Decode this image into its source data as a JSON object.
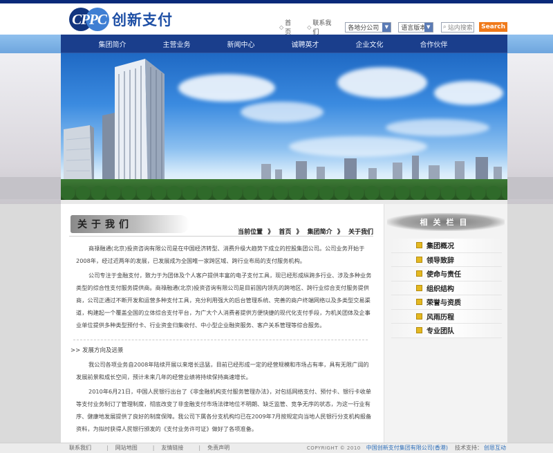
{
  "header": {
    "logo_mark": "CPPC",
    "logo_text": "创新支付",
    "links": [
      {
        "label": "首页"
      },
      {
        "label": "联系我们"
      }
    ],
    "region_select": "各地分公司",
    "language_select": "语言版本",
    "search_placeholder": "站内搜索",
    "search_button": "Search"
  },
  "nav": {
    "items": [
      "集团简介",
      "主营业务",
      "新闻中心",
      "诚聘英才",
      "企业文化",
      "合作伙伴"
    ]
  },
  "main": {
    "title": "关于我们",
    "breadcrumb": {
      "prefix": "当前位置",
      "sep": "》",
      "home": "首页",
      "section": "集团简介",
      "current": "关于我们"
    },
    "paragraphs": [
      "商祿融通(北京)投资咨询有限公司是在中国经济转型、消费升级大趋势下成立的控股集团公司。公司业务开始于2008年，经过近两年的发展，已发展成为全国唯一家跨区域、跨行业布局的支付服务机构。",
      "公司专注于金融支付，致力于为团体及个人客户提供丰富的电子支付工具，现已经形成纵跨多行业、涉及多种业务类型的综合性支付服务提供商。商祿融通(北京)投资咨询有限公司是目前国内领先的跨地区、跨行业综合支付服务提供商，公司正通过不断开发和运营多种支付工具，充分利用强大的后台管理系统、完善的商户终端网络以及多类型交易渠道，构建起一个覆盖全国的立体综合支付平台，为广大个人消费者提供方便快捷的现代化支付手段，为机关团体及企事业单位提供多种类型预付卡、行业资金归集收付、中小型企业融资服务、客户关系管理等综合服务。"
    ],
    "subhead": ">> 发展方向及远景",
    "paragraphs2": [
      "我公司各项业务自2008年陆续开展以来增长迅猛，目前已经形成一定的经营规模和市场占有率，具有无限广阔的发展前景和成长空间，预计未来几年的经营业绩将持续保持高速增长。",
      "2010年6月21日，中国人民银行出台了《非金融机构支付服务管理办法》，对包括网络支付、预付卡、银行卡收单等支付业务制订了管理制度，彻底改变了非金融支付市场法律地位不明朗、缺乏监管、竞争无序的状态，为这一行业有序、健康地发展提供了良好的制度保障。我公司下属各分支机构均已在2009年7月按规定向当地人民银行分支机构报备资料，为拟时获得人民银行颁发的《支付业务许可证》做好了各项准备。"
    ]
  },
  "sidebar": {
    "title": "相关栏目",
    "items": [
      "集团概况",
      "领导致辞",
      "使命与责任",
      "组织结构",
      "荣誉与资质",
      "风雨历程",
      "专业团队"
    ]
  },
  "footer": {
    "links": [
      "联系我们",
      "网站地图",
      "友情链接",
      "免责声明"
    ],
    "copyright": "COPYRIGHT © 2010",
    "company": "中国创新支付集团有限公司(香港)",
    "tech_label": "技术支持：",
    "tech_link": "创恩互动"
  },
  "colors": {
    "nav_bg": "#1a3e8c",
    "accent_blue": "#2e6fba",
    "search_button": "#f07a1a",
    "sidebar_marker": "#e4b820"
  }
}
